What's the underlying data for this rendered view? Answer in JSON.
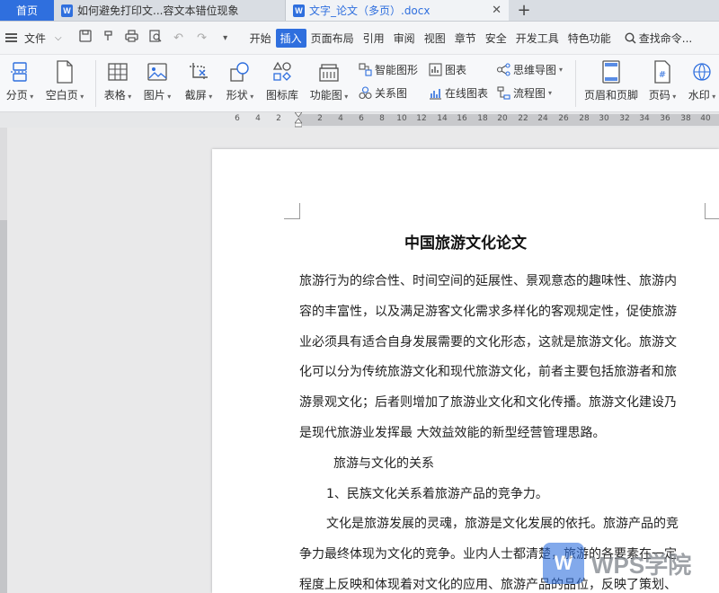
{
  "tabs": {
    "home": "首页",
    "doc1": "如何避免打印文...容文本错位现象",
    "doc2": "文字_论文（多页）.docx"
  },
  "menu": {
    "file": "文件",
    "items": [
      "开始",
      "插入",
      "页面布局",
      "引用",
      "审阅",
      "视图",
      "章节",
      "安全",
      "开发工具",
      "特色功能"
    ],
    "active": "插入",
    "search": "查找命令..."
  },
  "ribbon": {
    "page_break": "分页",
    "blank_page": "空白页",
    "table": "表格",
    "picture": "图片",
    "screenshot": "截屏",
    "shapes": "形状",
    "icon_library": "图标库",
    "function_chart": "功能图",
    "smart_art": "智能图形",
    "chart": "图表",
    "mind_map": "思维导图",
    "relation_chart": "关系图",
    "online_chart": "在线图表",
    "flowchart": "流程图",
    "header_footer": "页眉和页脚",
    "page_number": "页码",
    "watermark": "水印"
  },
  "ruler": {
    "numbers": [
      "6",
      "4",
      "2",
      "2",
      "4",
      "6",
      "8",
      "10",
      "12",
      "14",
      "16",
      "18",
      "20",
      "22",
      "24",
      "26",
      "28",
      "30",
      "32",
      "34",
      "36",
      "38",
      "40"
    ]
  },
  "document": {
    "title": "中国旅游文化论文",
    "lines": [
      "旅游行为的综合性、时间空间的延展性、景观意态的趣味性、旅游内",
      "容的丰富性，以及满足游客文化需求多样化的客观规定性，促使旅游",
      "业必须具有适合自身发展需要的文化形态，这就是旅游文化。旅游文",
      "化可以分为传统旅游文化和现代旅游文化，前者主要包括旅游者和旅",
      "游景观文化；后者则增加了旅游业文化和文化传播。旅游文化建设乃",
      "是现代旅游业发挥最 大效益效能的新型经营管理思路。",
      "旅游与文化的关系",
      "1、民族文化关系着旅游产品的竞争力。",
      "文化是旅游发展的灵魂，旅游是文化发展的依托。旅游产品的竞",
      "争力最终体现为文化的竞争。业内人士都清楚，旅游的各要素在一定",
      "程度上反映和体现着对文化的应用、旅游产品的品位，反映了策划、"
    ]
  },
  "watermark": {
    "logo_letter": "W",
    "text": "WPS学院"
  },
  "colors": {
    "accent": "#2f6fde"
  }
}
